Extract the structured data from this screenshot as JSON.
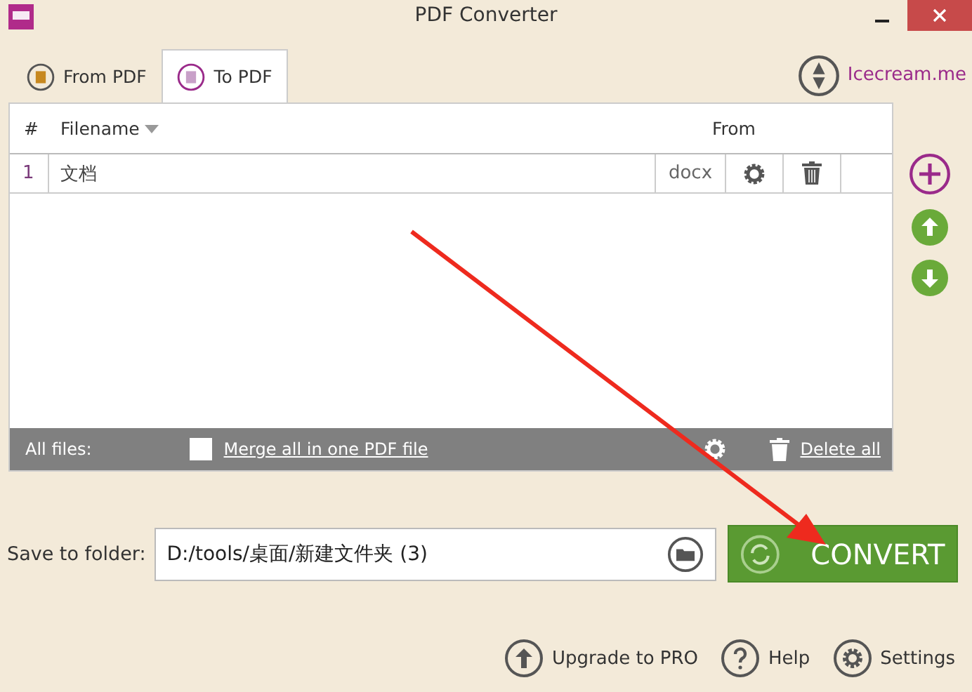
{
  "window": {
    "title": "PDF Converter"
  },
  "tabs": [
    {
      "label": "From PDF",
      "selected": false
    },
    {
      "label": "To PDF",
      "selected": true
    }
  ],
  "brand_link": "Icecream.me",
  "table": {
    "columns": [
      "#",
      "Filename",
      "From"
    ],
    "rows": [
      {
        "index": "1",
        "filename": "文档",
        "from": "docx"
      }
    ]
  },
  "all_files": {
    "label": "All files:",
    "merge_label": "Merge all in one PDF file",
    "merge_checked": false,
    "delete_label": "Delete all"
  },
  "save": {
    "label": "Save to folder:",
    "value": "D:/tools/桌面/新建文件夹 (3)"
  },
  "convert_button": "CONVERT",
  "footer_links": [
    "Upgrade to PRO",
    "Help",
    "Settings"
  ]
}
